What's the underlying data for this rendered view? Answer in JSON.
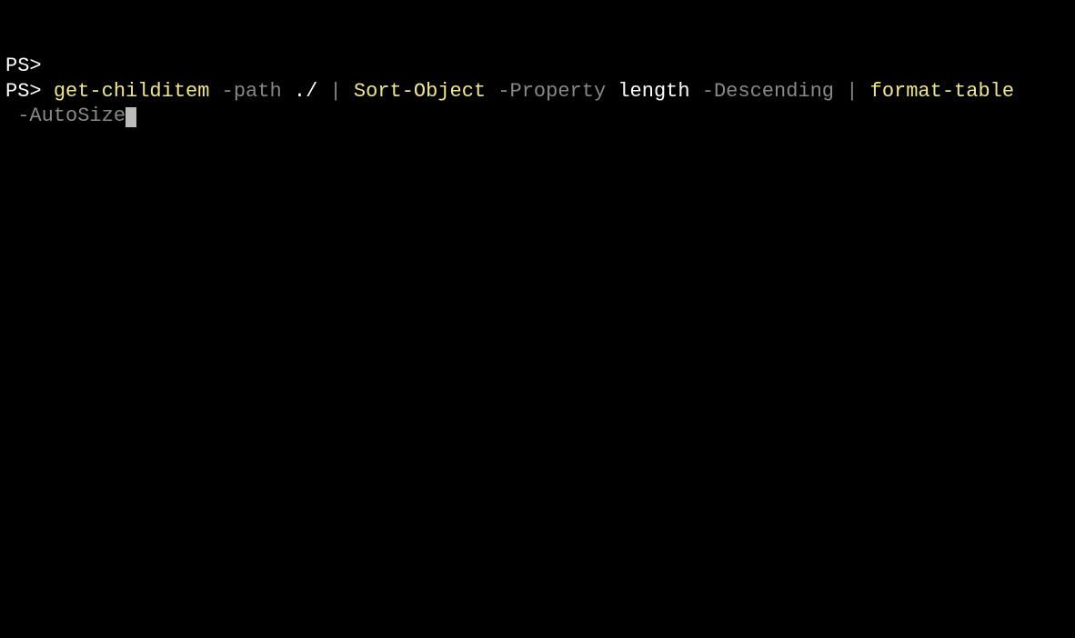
{
  "terminal": {
    "lines": [
      {
        "prompt": "PS>",
        "command": ""
      },
      {
        "prompt": "PS>",
        "tokens": [
          {
            "text": "get-childitem",
            "type": "cmdlet"
          },
          {
            "text": " ",
            "type": "space"
          },
          {
            "text": "-path",
            "type": "parameter"
          },
          {
            "text": " ",
            "type": "space"
          },
          {
            "text": "./",
            "type": "argument"
          },
          {
            "text": " ",
            "type": "space"
          },
          {
            "text": "|",
            "type": "operator"
          },
          {
            "text": " ",
            "type": "space"
          },
          {
            "text": "Sort-Object",
            "type": "cmdlet"
          },
          {
            "text": " ",
            "type": "space"
          },
          {
            "text": "-Property",
            "type": "parameter"
          },
          {
            "text": " ",
            "type": "space"
          },
          {
            "text": "length",
            "type": "argument"
          },
          {
            "text": " ",
            "type": "space"
          },
          {
            "text": "-Descending",
            "type": "parameter"
          },
          {
            "text": " ",
            "type": "space"
          },
          {
            "text": "|",
            "type": "operator"
          },
          {
            "text": " ",
            "type": "space"
          },
          {
            "text": "format-table",
            "type": "cmdlet"
          }
        ],
        "wrap_tokens": [
          {
            "text": " ",
            "type": "space"
          },
          {
            "text": "-AutoSize",
            "type": "parameter"
          }
        ]
      }
    ]
  }
}
